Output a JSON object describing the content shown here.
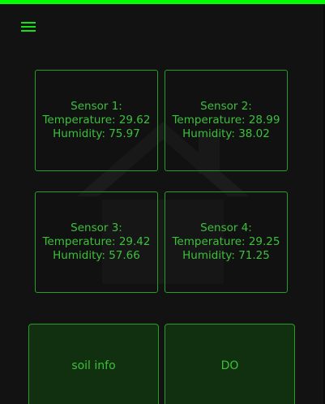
{
  "menu": {
    "icon": "hamburger-menu-icon"
  },
  "watermark": {
    "icon": "house-icon"
  },
  "colors": {
    "accent": "#00ff00",
    "card_border": "#23a023",
    "text": "#3cc03c",
    "background": "#121212",
    "button_fill": "#10300f"
  },
  "sensors": [
    {
      "title": "Sensor 1:",
      "temperature": "Temperature: 29.62",
      "humidity": "Humidity: 75.97"
    },
    {
      "title": "Sensor 2:",
      "temperature": "Temperature: 28.99",
      "humidity": "Humidity: 38.02"
    },
    {
      "title": "Sensor 3:",
      "temperature": "Temperature: 29.42",
      "humidity": "Humidity: 57.66"
    },
    {
      "title": "Sensor 4:",
      "temperature": "Temperature: 29.25",
      "humidity": "Humidity: 71.25"
    }
  ],
  "buttons": {
    "soil_info": "soil info",
    "do": "DO"
  }
}
